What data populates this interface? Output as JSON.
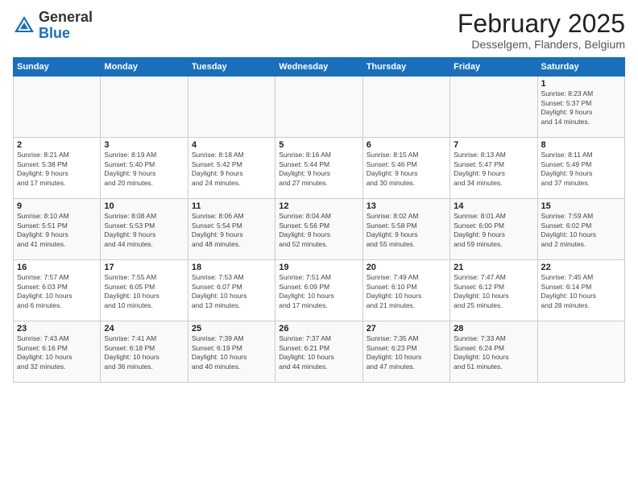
{
  "logo": {
    "general": "General",
    "blue": "Blue"
  },
  "title": {
    "month_year": "February 2025",
    "location": "Desselgem, Flanders, Belgium"
  },
  "days_of_week": [
    "Sunday",
    "Monday",
    "Tuesday",
    "Wednesday",
    "Thursday",
    "Friday",
    "Saturday"
  ],
  "weeks": [
    [
      {
        "day": "",
        "info": ""
      },
      {
        "day": "",
        "info": ""
      },
      {
        "day": "",
        "info": ""
      },
      {
        "day": "",
        "info": ""
      },
      {
        "day": "",
        "info": ""
      },
      {
        "day": "",
        "info": ""
      },
      {
        "day": "1",
        "info": "Sunrise: 8:23 AM\nSunset: 5:37 PM\nDaylight: 9 hours\nand 14 minutes."
      }
    ],
    [
      {
        "day": "2",
        "info": "Sunrise: 8:21 AM\nSunset: 5:38 PM\nDaylight: 9 hours\nand 17 minutes."
      },
      {
        "day": "3",
        "info": "Sunrise: 8:19 AM\nSunset: 5:40 PM\nDaylight: 9 hours\nand 20 minutes."
      },
      {
        "day": "4",
        "info": "Sunrise: 8:18 AM\nSunset: 5:42 PM\nDaylight: 9 hours\nand 24 minutes."
      },
      {
        "day": "5",
        "info": "Sunrise: 8:16 AM\nSunset: 5:44 PM\nDaylight: 9 hours\nand 27 minutes."
      },
      {
        "day": "6",
        "info": "Sunrise: 8:15 AM\nSunset: 5:46 PM\nDaylight: 9 hours\nand 30 minutes."
      },
      {
        "day": "7",
        "info": "Sunrise: 8:13 AM\nSunset: 5:47 PM\nDaylight: 9 hours\nand 34 minutes."
      },
      {
        "day": "8",
        "info": "Sunrise: 8:11 AM\nSunset: 5:49 PM\nDaylight: 9 hours\nand 37 minutes."
      }
    ],
    [
      {
        "day": "9",
        "info": "Sunrise: 8:10 AM\nSunset: 5:51 PM\nDaylight: 9 hours\nand 41 minutes."
      },
      {
        "day": "10",
        "info": "Sunrise: 8:08 AM\nSunset: 5:53 PM\nDaylight: 9 hours\nand 44 minutes."
      },
      {
        "day": "11",
        "info": "Sunrise: 8:06 AM\nSunset: 5:54 PM\nDaylight: 9 hours\nand 48 minutes."
      },
      {
        "day": "12",
        "info": "Sunrise: 8:04 AM\nSunset: 5:56 PM\nDaylight: 9 hours\nand 52 minutes."
      },
      {
        "day": "13",
        "info": "Sunrise: 8:02 AM\nSunset: 5:58 PM\nDaylight: 9 hours\nand 55 minutes."
      },
      {
        "day": "14",
        "info": "Sunrise: 8:01 AM\nSunset: 6:00 PM\nDaylight: 9 hours\nand 59 minutes."
      },
      {
        "day": "15",
        "info": "Sunrise: 7:59 AM\nSunset: 6:02 PM\nDaylight: 10 hours\nand 2 minutes."
      }
    ],
    [
      {
        "day": "16",
        "info": "Sunrise: 7:57 AM\nSunset: 6:03 PM\nDaylight: 10 hours\nand 6 minutes."
      },
      {
        "day": "17",
        "info": "Sunrise: 7:55 AM\nSunset: 6:05 PM\nDaylight: 10 hours\nand 10 minutes."
      },
      {
        "day": "18",
        "info": "Sunrise: 7:53 AM\nSunset: 6:07 PM\nDaylight: 10 hours\nand 13 minutes."
      },
      {
        "day": "19",
        "info": "Sunrise: 7:51 AM\nSunset: 6:09 PM\nDaylight: 10 hours\nand 17 minutes."
      },
      {
        "day": "20",
        "info": "Sunrise: 7:49 AM\nSunset: 6:10 PM\nDaylight: 10 hours\nand 21 minutes."
      },
      {
        "day": "21",
        "info": "Sunrise: 7:47 AM\nSunset: 6:12 PM\nDaylight: 10 hours\nand 25 minutes."
      },
      {
        "day": "22",
        "info": "Sunrise: 7:45 AM\nSunset: 6:14 PM\nDaylight: 10 hours\nand 28 minutes."
      }
    ],
    [
      {
        "day": "23",
        "info": "Sunrise: 7:43 AM\nSunset: 6:16 PM\nDaylight: 10 hours\nand 32 minutes."
      },
      {
        "day": "24",
        "info": "Sunrise: 7:41 AM\nSunset: 6:18 PM\nDaylight: 10 hours\nand 36 minutes."
      },
      {
        "day": "25",
        "info": "Sunrise: 7:39 AM\nSunset: 6:19 PM\nDaylight: 10 hours\nand 40 minutes."
      },
      {
        "day": "26",
        "info": "Sunrise: 7:37 AM\nSunset: 6:21 PM\nDaylight: 10 hours\nand 44 minutes."
      },
      {
        "day": "27",
        "info": "Sunrise: 7:35 AM\nSunset: 6:23 PM\nDaylight: 10 hours\nand 47 minutes."
      },
      {
        "day": "28",
        "info": "Sunrise: 7:33 AM\nSunset: 6:24 PM\nDaylight: 10 hours\nand 51 minutes."
      },
      {
        "day": "",
        "info": ""
      }
    ]
  ]
}
